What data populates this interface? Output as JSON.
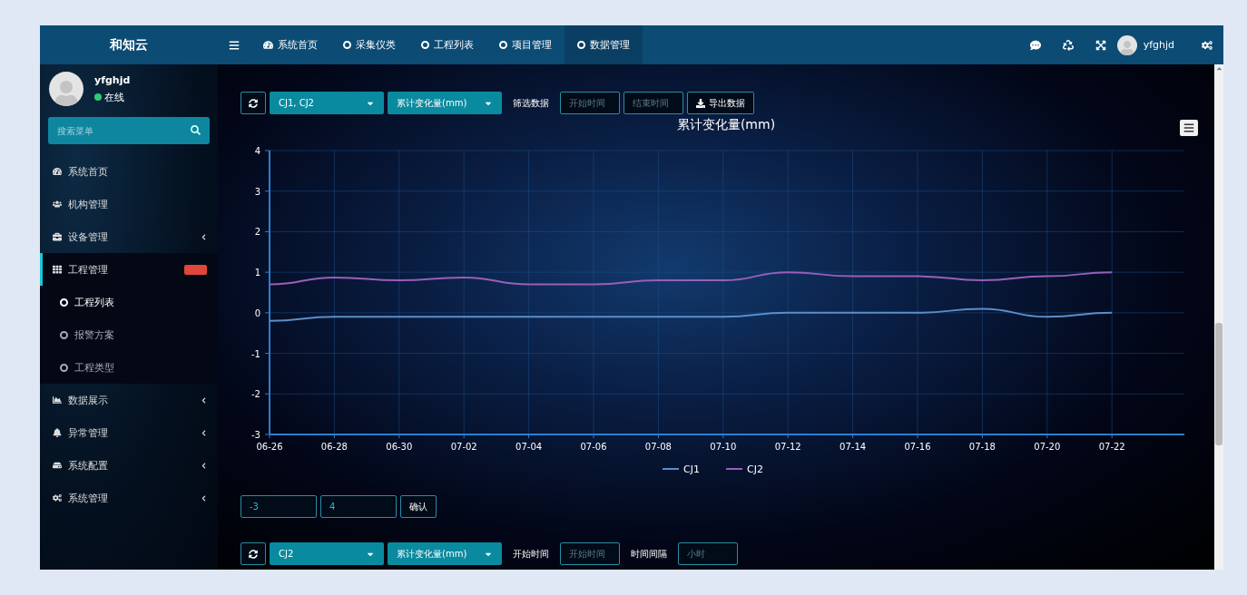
{
  "brand": "和知云",
  "nav_tabs": [
    {
      "label": "系统首页",
      "selected": false
    },
    {
      "label": "采集仪类",
      "selected": false
    },
    {
      "label": "工程列表",
      "selected": false
    },
    {
      "label": "项目管理",
      "selected": false
    },
    {
      "label": "数据管理",
      "selected": true
    }
  ],
  "top_user": "yfghjd",
  "profile": {
    "name": "yfghjd",
    "status": "在线"
  },
  "sidebar": {
    "search_placeholder": "搜索菜单",
    "items": [
      {
        "label": "系统首页",
        "expandable": false,
        "selected": false
      },
      {
        "label": "机构管理",
        "expandable": false,
        "selected": false
      },
      {
        "label": "设备管理",
        "expandable": true,
        "selected": false
      },
      {
        "label": "工程管理",
        "expandable": false,
        "selected": true,
        "badge": true,
        "children": [
          {
            "label": "工程列表",
            "selected": true
          },
          {
            "label": "报警方案",
            "selected": false
          },
          {
            "label": "工程类型",
            "selected": false
          }
        ]
      },
      {
        "label": "数据展示",
        "expandable": true,
        "selected": false
      },
      {
        "label": "异常管理",
        "expandable": true,
        "selected": false
      },
      {
        "label": "系统配置",
        "expandable": true,
        "selected": false
      },
      {
        "label": "系统管理",
        "expandable": true,
        "selected": false
      }
    ]
  },
  "filter_bar": {
    "sensors": "CJ1, CJ2",
    "metric": "累计变化量(mm)",
    "filter_label": "筛选数据",
    "start_placeholder": "开始时间",
    "end_placeholder": "结束时间",
    "export_button": "导出数据"
  },
  "chart_data": {
    "type": "line",
    "title": "累计变化量(mm)",
    "grid": true,
    "legend": true,
    "categories": [
      "06-26",
      "06-28",
      "06-30",
      "07-02",
      "07-04",
      "07-06",
      "07-08",
      "07-10",
      "07-12",
      "07-14",
      "07-16",
      "07-18",
      "07-20",
      "07-22"
    ],
    "series": [
      {
        "name": "CJ1",
        "color": "#5b8fc9",
        "values": [
          -0.2,
          -0.1,
          -0.1,
          -0.1,
          -0.1,
          -0.1,
          -0.1,
          -0.1,
          0,
          0,
          0,
          0.1,
          -0.1,
          0
        ]
      },
      {
        "name": "CJ2",
        "color": "#9a5fb8",
        "values": [
          0.7,
          0.87,
          0.8,
          0.87,
          0.7,
          0.7,
          0.8,
          0.8,
          1.0,
          0.9,
          0.9,
          0.8,
          0.9,
          1.0
        ]
      }
    ],
    "ylim": [
      -3,
      4
    ],
    "yticks": [
      -3,
      -2,
      -1,
      0,
      1,
      2,
      3,
      4
    ]
  },
  "range_bar": {
    "min": "-3",
    "max": "4",
    "confirm_button": "确认"
  },
  "second_filter_bar": {
    "sensors": "CJ2",
    "metric": "累计变化量(mm)",
    "start_label": "开始时间",
    "start_placeholder": "开始时间",
    "interval_label": "时间间隔",
    "interval_placeholder": "小时"
  }
}
